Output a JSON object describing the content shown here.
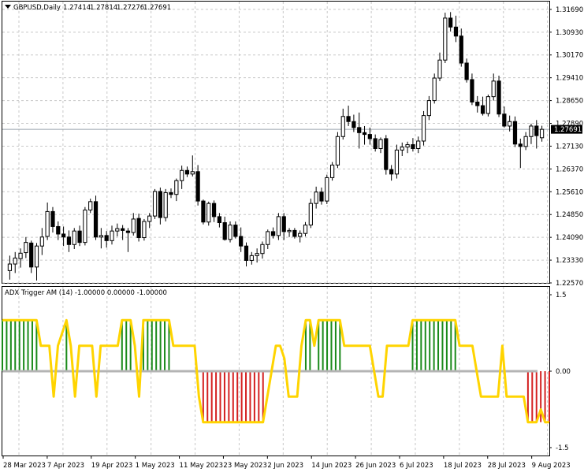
{
  "main_panel": {
    "symbol_label": "GBPUSD,Daily",
    "ohlc_values": [
      "1.27414",
      "1.27814",
      "1.27276",
      "1.27691"
    ],
    "y_ticks": [
      "1.31690",
      "1.30930",
      "1.30170",
      "1.29410",
      "1.28650",
      "1.27890",
      "1.27130",
      "1.26370",
      "1.25610",
      "1.24850",
      "1.24090",
      "1.23330",
      "1.22570"
    ],
    "price_badge": "1.27691",
    "badge_color": "#000000",
    "bull_fill": "#ffffff",
    "bear_fill": "#000000",
    "grid": true
  },
  "indicator_panel": {
    "title": "ADX Trigger AM (14) -1.00000 0.00000 -1.00000",
    "y_ticks": [
      "1.5",
      "0.00",
      "-1.5"
    ],
    "line_color": "#ffd400",
    "positive_color": "#1a8a1a",
    "negative_color": "#d42020",
    "zero_line_color": "#b4b4b4"
  },
  "x_axis": {
    "labels": [
      "28 Mar 2023",
      "7 Apr 2023",
      "19 Apr 2023",
      "1 May 2023",
      "11 May 2023",
      "23 May 2023",
      "2 Jun 2023",
      "14 Jun 2023",
      "26 Jun 2023",
      "6 Jul 2023",
      "18 Jul 2023",
      "28 Jul 2023",
      "9 Aug 2023"
    ]
  },
  "chart_data": [
    {
      "type": "candlestick",
      "symbol": "GBPUSD",
      "timeframe": "Daily",
      "ylim": [
        1.2257,
        1.3195
      ],
      "candles": [
        {
          "o": 1.2298,
          "h": 1.2348,
          "l": 1.2268,
          "c": 1.232
        },
        {
          "o": 1.232,
          "h": 1.236,
          "l": 1.229,
          "c": 1.234
        },
        {
          "o": 1.2338,
          "h": 1.2372,
          "l": 1.2308,
          "c": 1.2356
        },
        {
          "o": 1.2358,
          "h": 1.241,
          "l": 1.234,
          "c": 1.2392
        },
        {
          "o": 1.239,
          "h": 1.2398,
          "l": 1.229,
          "c": 1.231
        },
        {
          "o": 1.231,
          "h": 1.239,
          "l": 1.2265,
          "c": 1.238
        },
        {
          "o": 1.238,
          "h": 1.244,
          "l": 1.235,
          "c": 1.241
        },
        {
          "o": 1.2412,
          "h": 1.2525,
          "l": 1.24,
          "c": 1.2495
        },
        {
          "o": 1.2495,
          "h": 1.251,
          "l": 1.2425,
          "c": 1.2445
        },
        {
          "o": 1.2445,
          "h": 1.2462,
          "l": 1.24,
          "c": 1.242
        },
        {
          "o": 1.242,
          "h": 1.2445,
          "l": 1.238,
          "c": 1.241
        },
        {
          "o": 1.241,
          "h": 1.2432,
          "l": 1.236,
          "c": 1.2385
        },
        {
          "o": 1.2385,
          "h": 1.244,
          "l": 1.237,
          "c": 1.243
        },
        {
          "o": 1.243,
          "h": 1.2448,
          "l": 1.238,
          "c": 1.2392
        },
        {
          "o": 1.2392,
          "h": 1.251,
          "l": 1.2382,
          "c": 1.25
        },
        {
          "o": 1.25,
          "h": 1.2538,
          "l": 1.249,
          "c": 1.2528
        },
        {
          "o": 1.2528,
          "h": 1.2548,
          "l": 1.24,
          "c": 1.241
        },
        {
          "o": 1.241,
          "h": 1.244,
          "l": 1.2372,
          "c": 1.2415
        },
        {
          "o": 1.2415,
          "h": 1.243,
          "l": 1.2375,
          "c": 1.2398
        },
        {
          "o": 1.2398,
          "h": 1.2448,
          "l": 1.2385,
          "c": 1.243
        },
        {
          "o": 1.243,
          "h": 1.2455,
          "l": 1.2412,
          "c": 1.2438
        },
        {
          "o": 1.2438,
          "h": 1.245,
          "l": 1.24,
          "c": 1.2432
        },
        {
          "o": 1.243,
          "h": 1.244,
          "l": 1.236,
          "c": 1.2425
        },
        {
          "o": 1.2425,
          "h": 1.249,
          "l": 1.2415,
          "c": 1.247
        },
        {
          "o": 1.2472,
          "h": 1.2488,
          "l": 1.2395,
          "c": 1.2408
        },
        {
          "o": 1.2408,
          "h": 1.247,
          "l": 1.2398,
          "c": 1.2462
        },
        {
          "o": 1.2462,
          "h": 1.249,
          "l": 1.244,
          "c": 1.248
        },
        {
          "o": 1.248,
          "h": 1.257,
          "l": 1.247,
          "c": 1.2562
        },
        {
          "o": 1.2562,
          "h": 1.2575,
          "l": 1.2452,
          "c": 1.2475
        },
        {
          "o": 1.2475,
          "h": 1.257,
          "l": 1.2462,
          "c": 1.2558
        },
        {
          "o": 1.2558,
          "h": 1.2572,
          "l": 1.254,
          "c": 1.2552
        },
        {
          "o": 1.2552,
          "h": 1.2605,
          "l": 1.253,
          "c": 1.2598
        },
        {
          "o": 1.2598,
          "h": 1.2648,
          "l": 1.257,
          "c": 1.2632
        },
        {
          "o": 1.2632,
          "h": 1.2645,
          "l": 1.261,
          "c": 1.262
        },
        {
          "o": 1.262,
          "h": 1.2682,
          "l": 1.2612,
          "c": 1.2628
        },
        {
          "o": 1.2628,
          "h": 1.265,
          "l": 1.2515,
          "c": 1.253
        },
        {
          "o": 1.253,
          "h": 1.2535,
          "l": 1.2452,
          "c": 1.246
        },
        {
          "o": 1.246,
          "h": 1.2528,
          "l": 1.2448,
          "c": 1.2522
        },
        {
          "o": 1.2522,
          "h": 1.2532,
          "l": 1.246,
          "c": 1.2478
        },
        {
          "o": 1.2478,
          "h": 1.249,
          "l": 1.2442,
          "c": 1.2458
        },
        {
          "o": 1.2458,
          "h": 1.2478,
          "l": 1.2398,
          "c": 1.2402
        },
        {
          "o": 1.2402,
          "h": 1.2462,
          "l": 1.2392,
          "c": 1.245
        },
        {
          "o": 1.245,
          "h": 1.2462,
          "l": 1.2405,
          "c": 1.2412
        },
        {
          "o": 1.2412,
          "h": 1.2442,
          "l": 1.236,
          "c": 1.238
        },
        {
          "o": 1.238,
          "h": 1.2392,
          "l": 1.2312,
          "c": 1.2332
        },
        {
          "o": 1.2332,
          "h": 1.236,
          "l": 1.2318,
          "c": 1.2348
        },
        {
          "o": 1.2348,
          "h": 1.2372,
          "l": 1.2325,
          "c": 1.2355
        },
        {
          "o": 1.2355,
          "h": 1.2395,
          "l": 1.2338,
          "c": 1.2385
        },
        {
          "o": 1.2385,
          "h": 1.2435,
          "l": 1.237,
          "c": 1.2428
        },
        {
          "o": 1.2428,
          "h": 1.2442,
          "l": 1.2405,
          "c": 1.2415
        },
        {
          "o": 1.2415,
          "h": 1.249,
          "l": 1.24,
          "c": 1.2478
        },
        {
          "o": 1.2478,
          "h": 1.249,
          "l": 1.24,
          "c": 1.2428
        },
        {
          "o": 1.2428,
          "h": 1.244,
          "l": 1.241,
          "c": 1.2432
        },
        {
          "o": 1.2432,
          "h": 1.244,
          "l": 1.2405,
          "c": 1.2412
        },
        {
          "o": 1.2412,
          "h": 1.2432,
          "l": 1.2392,
          "c": 1.2422
        },
        {
          "o": 1.2422,
          "h": 1.246,
          "l": 1.2412,
          "c": 1.245
        },
        {
          "o": 1.245,
          "h": 1.2538,
          "l": 1.244,
          "c": 1.2522
        },
        {
          "o": 1.2522,
          "h": 1.2578,
          "l": 1.2505,
          "c": 1.256
        },
        {
          "o": 1.256,
          "h": 1.2575,
          "l": 1.2518,
          "c": 1.253
        },
        {
          "o": 1.253,
          "h": 1.2618,
          "l": 1.252,
          "c": 1.2608
        },
        {
          "o": 1.2608,
          "h": 1.266,
          "l": 1.2598,
          "c": 1.265
        },
        {
          "o": 1.265,
          "h": 1.276,
          "l": 1.264,
          "c": 1.2745
        },
        {
          "o": 1.2745,
          "h": 1.2838,
          "l": 1.2735,
          "c": 1.2812
        },
        {
          "o": 1.2812,
          "h": 1.2848,
          "l": 1.278,
          "c": 1.2795
        },
        {
          "o": 1.2795,
          "h": 1.2818,
          "l": 1.276,
          "c": 1.2775
        },
        {
          "o": 1.2775,
          "h": 1.2825,
          "l": 1.2705,
          "c": 1.2758
        },
        {
          "o": 1.2758,
          "h": 1.278,
          "l": 1.2718,
          "c": 1.2752
        },
        {
          "o": 1.2752,
          "h": 1.2775,
          "l": 1.2718,
          "c": 1.2738
        },
        {
          "o": 1.2738,
          "h": 1.2752,
          "l": 1.2695,
          "c": 1.2705
        },
        {
          "o": 1.2705,
          "h": 1.2742,
          "l": 1.269,
          "c": 1.2735
        },
        {
          "o": 1.2738,
          "h": 1.275,
          "l": 1.2618,
          "c": 1.2635
        },
        {
          "o": 1.2635,
          "h": 1.265,
          "l": 1.2598,
          "c": 1.262
        },
        {
          "o": 1.262,
          "h": 1.2718,
          "l": 1.2605,
          "c": 1.27
        },
        {
          "o": 1.27,
          "h": 1.2725,
          "l": 1.268,
          "c": 1.271
        },
        {
          "o": 1.271,
          "h": 1.2728,
          "l": 1.269,
          "c": 1.2718
        },
        {
          "o": 1.2718,
          "h": 1.274,
          "l": 1.2695,
          "c": 1.2705
        },
        {
          "o": 1.2705,
          "h": 1.2745,
          "l": 1.269,
          "c": 1.273
        },
        {
          "o": 1.273,
          "h": 1.283,
          "l": 1.2715,
          "c": 1.2815
        },
        {
          "o": 1.2815,
          "h": 1.288,
          "l": 1.28,
          "c": 1.2865
        },
        {
          "o": 1.2865,
          "h": 1.2955,
          "l": 1.2855,
          "c": 1.294
        },
        {
          "o": 1.294,
          "h": 1.3025,
          "l": 1.293,
          "c": 1.3
        },
        {
          "o": 1.3,
          "h": 1.3158,
          "l": 1.299,
          "c": 1.314
        },
        {
          "o": 1.314,
          "h": 1.316,
          "l": 1.3095,
          "c": 1.311
        },
        {
          "o": 1.311,
          "h": 1.3148,
          "l": 1.306,
          "c": 1.308
        },
        {
          "o": 1.308,
          "h": 1.3105,
          "l": 1.2978,
          "c": 1.299
        },
        {
          "o": 1.299,
          "h": 1.3005,
          "l": 1.2925,
          "c": 1.2935
        },
        {
          "o": 1.2935,
          "h": 1.2955,
          "l": 1.285,
          "c": 1.286
        },
        {
          "o": 1.286,
          "h": 1.288,
          "l": 1.2825,
          "c": 1.2848
        },
        {
          "o": 1.2848,
          "h": 1.2878,
          "l": 1.2815,
          "c": 1.2822
        },
        {
          "o": 1.2822,
          "h": 1.2885,
          "l": 1.2812,
          "c": 1.2878
        },
        {
          "o": 1.2878,
          "h": 1.2955,
          "l": 1.2865,
          "c": 1.293
        },
        {
          "o": 1.293,
          "h": 1.2948,
          "l": 1.281,
          "c": 1.282
        },
        {
          "o": 1.282,
          "h": 1.2845,
          "l": 1.2775,
          "c": 1.278
        },
        {
          "o": 1.278,
          "h": 1.2815,
          "l": 1.2762,
          "c": 1.2795
        },
        {
          "o": 1.2795,
          "h": 1.2812,
          "l": 1.271,
          "c": 1.272
        },
        {
          "o": 1.272,
          "h": 1.2738,
          "l": 1.264,
          "c": 1.2712
        },
        {
          "o": 1.2712,
          "h": 1.276,
          "l": 1.27,
          "c": 1.2745
        },
        {
          "o": 1.2745,
          "h": 1.2788,
          "l": 1.272,
          "c": 1.278
        },
        {
          "o": 1.278,
          "h": 1.28,
          "l": 1.2705,
          "c": 1.2748
        },
        {
          "o": 1.2741,
          "h": 1.2781,
          "l": 1.2728,
          "c": 1.2769
        }
      ]
    },
    {
      "type": "line",
      "name": "ADX Trigger AM (14)",
      "ylim": [
        -1.5,
        1.5
      ],
      "values": [
        1,
        1,
        1,
        1,
        1,
        1,
        1,
        1,
        1,
        0.5,
        0.5,
        0.5,
        -0.5,
        0.5,
        0.75,
        1,
        0.5,
        -0.5,
        0.5,
        0.5,
        0.5,
        0.5,
        -0.5,
        0.5,
        0.5,
        0.5,
        0.5,
        0.5,
        1,
        1,
        1,
        0.5,
        -0.5,
        1,
        1,
        1,
        1,
        1,
        1,
        1,
        0.5,
        0.5,
        0.5,
        0.5,
        0.5,
        0.5,
        -0.5,
        -1,
        -1,
        -1,
        -1,
        -1,
        -1,
        -1,
        -1,
        -1,
        -1,
        -1,
        -1,
        -1,
        -1,
        -1,
        -0.5,
        0,
        0.5,
        0.5,
        0.25,
        -0.5,
        -0.5,
        -0.5,
        0.5,
        1,
        1,
        0.5,
        1,
        1,
        1,
        1,
        1,
        1,
        0.5,
        0.5,
        0.5,
        0.5,
        0.5,
        0.5,
        0.5,
        0,
        -0.5,
        -0.5,
        0.5,
        0.5,
        0.5,
        0.5,
        0.5,
        0.5,
        1,
        1,
        1,
        1,
        1,
        1,
        1,
        1,
        1,
        1,
        1,
        0.5,
        0.5,
        0.5,
        0.5,
        0,
        -0.5,
        -0.5,
        -0.5,
        -0.5,
        -0.5,
        0.5,
        -0.5,
        -0.5,
        -0.5,
        -0.5,
        -0.5,
        -1,
        -1,
        -1,
        -0.75,
        -1,
        -1
      ]
    }
  ]
}
